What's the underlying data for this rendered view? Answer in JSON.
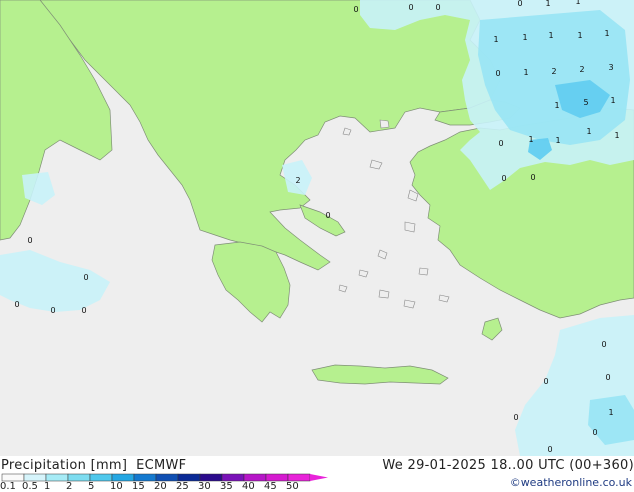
{
  "header": {
    "title": "Precipitation [mm]  ECMWF",
    "valid_time": "We 29-01-2025 18..00 UTC (00+360)",
    "credit": "©weatheronline.co.uk"
  },
  "legend": {
    "tick_labels": [
      "0.1",
      "0.5",
      "1",
      "2",
      "5",
      "10",
      "15",
      "20",
      "25",
      "30",
      "35",
      "40",
      "45",
      "50"
    ],
    "colors": [
      "#fafafa",
      "#d6f4fb",
      "#a6ebf6",
      "#7ddcf0",
      "#4fc8ec",
      "#25a7e3",
      "#1479cf",
      "#0f4fb3",
      "#0a2a96",
      "#2b0b8c",
      "#7a12b8",
      "#b616c8",
      "#d51ad0",
      "#e823d9"
    ]
  },
  "map": {
    "sea_color": "#eeeeee",
    "land_color": "#b6f08f",
    "precip_light": "#c8f2f8",
    "precip_mid": "#98e4f4",
    "precip_strong": "#63cdf0",
    "values": [
      {
        "label": "0"
      },
      {
        "label": "0"
      },
      {
        "label": "0"
      },
      {
        "label": "0"
      },
      {
        "label": "1"
      },
      {
        "label": "1"
      },
      {
        "label": "1"
      },
      {
        "label": "1"
      },
      {
        "label": "1"
      },
      {
        "label": "1"
      },
      {
        "label": "1"
      },
      {
        "label": "0"
      },
      {
        "label": "1"
      },
      {
        "label": "2"
      },
      {
        "label": "2"
      },
      {
        "label": "3"
      },
      {
        "label": "1"
      },
      {
        "label": "1"
      },
      {
        "label": "5"
      },
      {
        "label": "1"
      },
      {
        "label": "1"
      },
      {
        "label": "0"
      },
      {
        "label": "1"
      },
      {
        "label": "1"
      },
      {
        "label": "0"
      },
      {
        "label": "0"
      },
      {
        "label": "2"
      },
      {
        "label": "0"
      },
      {
        "label": "0"
      },
      {
        "label": "0"
      },
      {
        "label": "0"
      },
      {
        "label": "0"
      },
      {
        "label": "0"
      },
      {
        "label": "0"
      },
      {
        "label": "0"
      },
      {
        "label": "0"
      },
      {
        "label": "1"
      },
      {
        "label": "0"
      },
      {
        "label": "0"
      },
      {
        "label": "0"
      }
    ]
  }
}
